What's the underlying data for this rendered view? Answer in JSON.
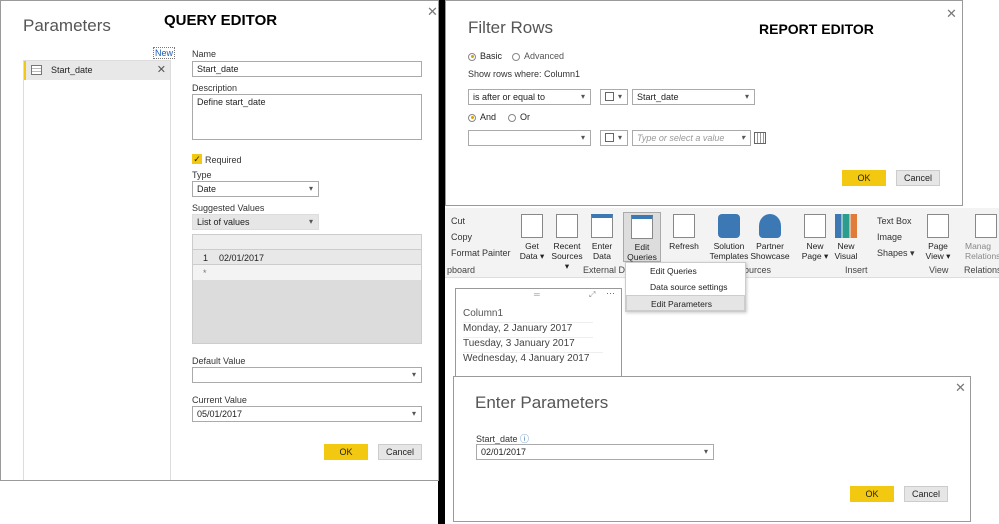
{
  "query_editor": {
    "title": "Parameters",
    "caption": "QUERY EDITOR",
    "new_link": "New",
    "list": [
      {
        "label": "Start_date"
      }
    ],
    "name_label": "Name",
    "name_value": "Start_date",
    "description_label": "Description",
    "description_value": "Define start_date",
    "required_label": "Required",
    "required_checked": true,
    "type_label": "Type",
    "type_value": "Date",
    "suggested_label": "Suggested Values",
    "suggested_value": "List of values",
    "grid_rows": [
      {
        "num": "1",
        "value": "02/01/2017"
      },
      {
        "num": "*",
        "value": ""
      }
    ],
    "default_label": "Default Value",
    "default_value": "",
    "current_label": "Current Value",
    "current_value": "05/01/2017",
    "ok": "OK",
    "cancel": "Cancel"
  },
  "filter_rows": {
    "title": "Filter Rows",
    "caption": "REPORT EDITOR",
    "basic": "Basic",
    "advanced": "Advanced",
    "mode": "Basic",
    "show_rows": "Show rows where: Column1",
    "operator1": "is after or equal to",
    "value1": "Start_date",
    "and": "And",
    "or": "Or",
    "logic": "And",
    "operator2": "",
    "value2_placeholder": "Type or select a value",
    "ok": "OK",
    "cancel": "Cancel"
  },
  "ribbon": {
    "clipboard": [
      "Cut",
      "Copy",
      "Format Painter"
    ],
    "clipboard_group": "pboard",
    "buttons": [
      {
        "label": "Get\nData ▾",
        "l1": "Get",
        "l2": "Data ▾"
      },
      {
        "l1": "Recent",
        "l2": "Sources ▾"
      },
      {
        "l1": "Enter",
        "l2": "Data"
      },
      {
        "l1": "Edit",
        "l2": "Queries ▾"
      },
      {
        "l1": "Refresh",
        "l2": ""
      },
      {
        "l1": "Solution",
        "l2": "Templates"
      },
      {
        "l1": "Partner",
        "l2": "Showcase"
      },
      {
        "l1": "New",
        "l2": "Page ▾"
      },
      {
        "l1": "New",
        "l2": "Visual"
      },
      {
        "l1": "Page",
        "l2": "View ▾"
      },
      {
        "l1": "Manag",
        "l2": "Relations"
      }
    ],
    "insert_small": [
      "Text Box",
      "Image",
      "Shapes ▾"
    ],
    "groups": [
      "External Da",
      "ources",
      "Insert",
      "View",
      "Relations"
    ],
    "dropdown": [
      "Edit Queries",
      "Data source settings",
      "Edit Parameters"
    ]
  },
  "table_visual": {
    "header": "Column1",
    "rows": [
      "Monday, 2 January 2017",
      "Tuesday, 3 January 2017",
      "Wednesday, 4 January 2017"
    ]
  },
  "enter_params": {
    "title": "Enter Parameters",
    "label": "Start_date",
    "info_icon": "ⓘ",
    "value": "02/01/2017",
    "ok": "OK",
    "cancel": "Cancel"
  }
}
